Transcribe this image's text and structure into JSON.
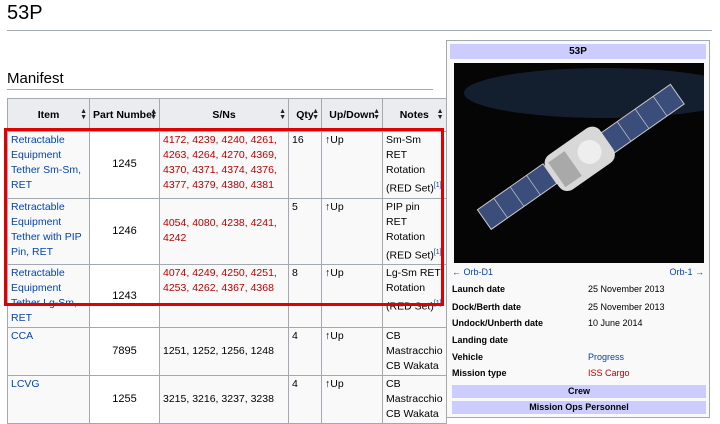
{
  "page_title": "53P",
  "section_title": "Manifest",
  "table": {
    "headers": [
      "Item",
      "Part Number",
      "S/Ns",
      "Qty",
      "Up/Down",
      "Notes"
    ],
    "rows": [
      {
        "item": "Retractable Equipment Tether Sm-Sm, RET",
        "part": "1245",
        "sns": "4172, 4239, 4240, 4261, 4263, 4264, 4270, 4369, 4370, 4371, 4374, 4376, 4377, 4379, 4380, 4381",
        "qty": "16",
        "updown": "↑Up",
        "notes": "Sm-Sm RET Rotation (RED Set)",
        "ref": "[1]"
      },
      {
        "item": "Retractable Equipment Tether with PIP Pin, RET",
        "part": "1246",
        "sns": "4054, 4080, 4238, 4241, 4242",
        "qty": "5",
        "updown": "↑Up",
        "notes": "PIP pin RET Rotation (RED Set)",
        "ref": "[1]"
      },
      {
        "item": "Retractable Equipment Tether Lg-Sm, RET",
        "part": "1243",
        "sns": "4074, 4249, 4250, 4251, 4253, 4262, 4367, 4368",
        "qty": "8",
        "updown": "↑Up",
        "notes": "Lg-Sm RET Rotation (RED Set)",
        "ref": "[1]"
      },
      {
        "item": "CCA",
        "part": "7895",
        "sns": "1251, 1252, 1256, 1248",
        "qty": "4",
        "updown": "↑Up",
        "notes": "CB Mastracchio CB Wakata",
        "ref": ""
      },
      {
        "item": "LCVG",
        "part": "1255",
        "sns": "3215, 3216, 3237, 3238",
        "qty": "4",
        "updown": "↑Up",
        "notes": "CB Mastracchio CB Wakata",
        "ref": ""
      }
    ]
  },
  "infobox": {
    "title": "53P",
    "nav_prev": "← Orb-D1",
    "nav_next": "Orb-1 →",
    "fields": [
      {
        "label": "Launch date",
        "value": "25 November 2013"
      },
      {
        "label": "Dock/Berth date",
        "value": "25 November 2013"
      },
      {
        "label": "Undock/Unberth date",
        "value": "10 June 2014"
      },
      {
        "label": "Landing date",
        "value": ""
      },
      {
        "label": "Vehicle",
        "value": "Progress"
      },
      {
        "label": "Mission type",
        "value": "ISS Cargo"
      }
    ],
    "crew_label": "Crew",
    "mission_ops_label": "Mission Ops Personnel"
  }
}
